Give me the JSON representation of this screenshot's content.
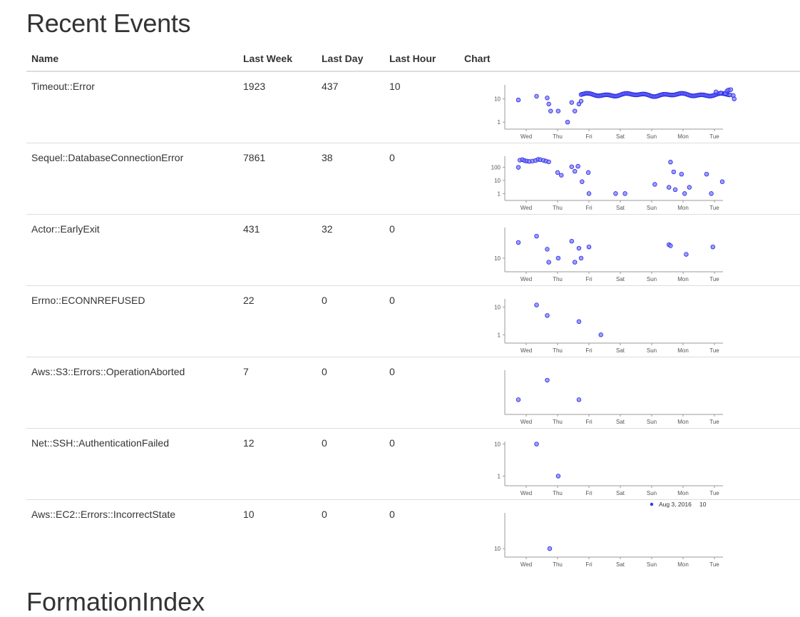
{
  "page": {
    "title": "Recent Events",
    "next_section_title": "FormationIndex"
  },
  "table": {
    "headers": {
      "name": "Name",
      "last_week": "Last Week",
      "last_day": "Last Day",
      "last_hour": "Last Hour",
      "chart": "Chart"
    },
    "rows": [
      {
        "name": "Timeout::Error",
        "last_week": "1923",
        "last_day": "437",
        "last_hour": "10"
      },
      {
        "name": "Sequel::DatabaseConnectionError",
        "last_week": "7861",
        "last_day": "38",
        "last_hour": "0"
      },
      {
        "name": "Actor::EarlyExit",
        "last_week": "431",
        "last_day": "32",
        "last_hour": "0"
      },
      {
        "name": "Errno::ECONNREFUSED",
        "last_week": "22",
        "last_day": "0",
        "last_hour": "0"
      },
      {
        "name": "Aws::S3::Errors::OperationAborted",
        "last_week": "7",
        "last_day": "0",
        "last_hour": "0"
      },
      {
        "name": "Net::SSH::AuthenticationFailed",
        "last_week": "12",
        "last_day": "0",
        "last_hour": "0"
      },
      {
        "name": "Aws::EC2::Errors::IncorrectState",
        "last_week": "10",
        "last_day": "0",
        "last_hour": "0"
      }
    ]
  },
  "tooltip": {
    "date": "Aug  3, 2016",
    "value": "10",
    "dot_color": "#3333ee"
  },
  "colors": {
    "dot_fill": "#8080ff",
    "dot_stroke": "#2020e0",
    "rule": "#dddddd"
  },
  "chart_data": [
    {
      "type": "scatter",
      "title": "Timeout::Error",
      "y_scale": "log",
      "x_ticks": [
        "Wed",
        "Thu",
        "Fri",
        "Sat",
        "Sun",
        "Mon",
        "Tue"
      ],
      "y_ticks": [
        {
          "label": "10",
          "value": 10
        },
        {
          "label": "1",
          "value": 1
        }
      ],
      "ylim": [
        0.5,
        40
      ],
      "x": [
        -0.25,
        0.33,
        0.67,
        0.72,
        0.78,
        1.02,
        1.32,
        1.45,
        1.55,
        1.68,
        1.75
      ],
      "y": [
        9,
        13,
        11,
        6,
        3,
        3,
        1,
        7,
        3,
        6,
        8
      ],
      "dense_band": {
        "x_start": 1.75,
        "x_end": 6.5,
        "base": 15,
        "amplitude": 2.5
      },
      "extra": {
        "x": [
          6.05,
          6.2,
          6.35,
          6.4,
          6.45,
          6.52,
          6.6,
          6.63
        ],
        "y": [
          20,
          18,
          17,
          22,
          24,
          25,
          14,
          10
        ]
      }
    },
    {
      "type": "scatter",
      "title": "Sequel::DatabaseConnectionError",
      "y_scale": "log",
      "x_ticks": [
        "Wed",
        "Thu",
        "Fri",
        "Sat",
        "Sun",
        "Mon",
        "Tue"
      ],
      "y_ticks": [
        {
          "label": "100",
          "value": 100
        },
        {
          "label": "10",
          "value": 10
        },
        {
          "label": "1",
          "value": 1
        }
      ],
      "ylim": [
        0.3,
        700
      ],
      "x": [
        -0.25,
        -0.2,
        -0.12,
        -0.05,
        0.02,
        0.1,
        0.2,
        0.3,
        0.38,
        0.45,
        0.55,
        0.63,
        0.72,
        1.0,
        1.12,
        1.45,
        1.55,
        1.65,
        1.78,
        1.98,
        2.0,
        2.85,
        3.15,
        4.1,
        4.55,
        4.6,
        4.7,
        4.75,
        4.95,
        5.05,
        5.2,
        5.75,
        5.9,
        6.25
      ],
      "y": [
        100,
        350,
        380,
        320,
        300,
        280,
        300,
        330,
        400,
        380,
        340,
        300,
        260,
        40,
        25,
        110,
        50,
        120,
        8,
        40,
        1,
        1,
        1,
        5,
        3,
        250,
        45,
        2,
        30,
        1,
        3,
        30,
        1,
        8
      ]
    },
    {
      "type": "scatter",
      "title": "Actor::EarlyExit",
      "y_scale": "log",
      "x_ticks": [
        "Wed",
        "Thu",
        "Fri",
        "Sat",
        "Sun",
        "Mon",
        "Tue"
      ],
      "y_ticks": [
        {
          "label": "10",
          "value": 10
        }
      ],
      "ylim": [
        3,
        150
      ],
      "x": [
        -0.25,
        0.33,
        0.67,
        0.72,
        1.02,
        1.45,
        1.55,
        1.68,
        1.75,
        2.0,
        4.55,
        4.6,
        5.1,
        5.95
      ],
      "y": [
        40,
        70,
        22,
        7,
        10,
        45,
        7,
        24,
        10,
        27,
        33,
        30,
        14,
        27
      ]
    },
    {
      "type": "scatter",
      "title": "Errno::ECONNREFUSED",
      "y_scale": "log",
      "x_ticks": [
        "Wed",
        "Thu",
        "Fri",
        "Sat",
        "Sun",
        "Mon",
        "Tue"
      ],
      "y_ticks": [
        {
          "label": "10",
          "value": 10
        },
        {
          "label": "1",
          "value": 1
        }
      ],
      "ylim": [
        0.5,
        20
      ],
      "x": [
        0.33,
        0.67,
        1.68,
        2.38
      ],
      "y": [
        12,
        5,
        3,
        1
      ]
    },
    {
      "type": "scatter",
      "title": "Aws::S3::Errors::OperationAborted",
      "y_scale": "log",
      "x_ticks": [
        "Wed",
        "Thu",
        "Fri",
        "Sat",
        "Sun",
        "Mon",
        "Tue"
      ],
      "y_ticks": [],
      "ylim": [
        0.5,
        4
      ],
      "x": [
        -0.25,
        0.67,
        1.68
      ],
      "y": [
        1,
        2.5,
        1
      ]
    },
    {
      "type": "scatter",
      "title": "Net::SSH::AuthenticationFailed",
      "y_scale": "log",
      "x_ticks": [
        "Wed",
        "Thu",
        "Fri",
        "Sat",
        "Sun",
        "Mon",
        "Tue"
      ],
      "y_ticks": [
        {
          "label": "10",
          "value": 10
        },
        {
          "label": "1",
          "value": 1
        }
      ],
      "ylim": [
        0.5,
        12
      ],
      "x": [
        0.33,
        1.02
      ],
      "y": [
        10,
        1
      ]
    },
    {
      "type": "scatter",
      "title": "Aws::EC2::Errors::IncorrectState",
      "y_scale": "log",
      "x_ticks": [
        "Wed",
        "Thu",
        "Fri",
        "Sat",
        "Sun",
        "Mon",
        "Tue"
      ],
      "y_ticks": [
        {
          "label": "10",
          "value": 10
        }
      ],
      "ylim": [
        7,
        45
      ],
      "x": [
        0.75
      ],
      "y": [
        10
      ]
    }
  ]
}
